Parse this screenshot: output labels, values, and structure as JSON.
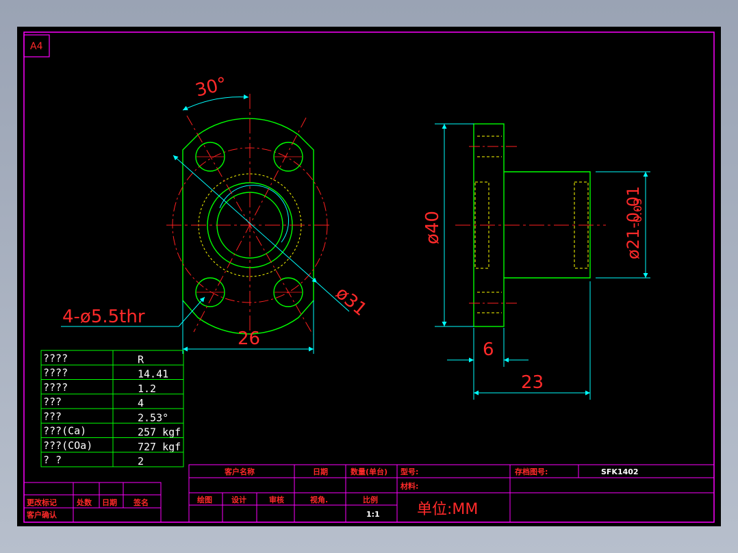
{
  "sheet": {
    "size_label": "A4"
  },
  "front_view": {
    "angle_label": "30°",
    "holes_label": "4-ø5.5thr",
    "pcd_label": "ø31",
    "width_label": "26"
  },
  "side_view": {
    "flange_dia_label": "ø40",
    "shaft_dia_label": "ø21-0.01",
    "shaft_dia_tol": "-0.03",
    "flange_thk_label": "6",
    "length_label": "23"
  },
  "spec_table": {
    "rows": [
      {
        "key": "????",
        "value": "R"
      },
      {
        "key": "????",
        "value": "14.41"
      },
      {
        "key": "????",
        "value": "1.2"
      },
      {
        "key": "???",
        "value": "4"
      },
      {
        "key": "???",
        "value": "2.53°"
      },
      {
        "key": "???(Ca)",
        "value": "257 kgf"
      },
      {
        "key": "???(COa)",
        "value": "727 kgf"
      },
      {
        "key": "?   ?",
        "value": "2"
      }
    ]
  },
  "revision_block": {
    "change_mark": "更改标记",
    "location": "处数",
    "date": "日期",
    "signature": "签名",
    "customer_confirm": "客户确认"
  },
  "title_block": {
    "customer_name": "客户名称",
    "date": "日期",
    "quantity": "数量(单台)",
    "model": "型号:",
    "archive_no": "存档图号:",
    "archive_value": "SFK1402",
    "material": "材料:",
    "drawn": "绘图",
    "design": "设计",
    "review": "审核",
    "view_angle": "视角.",
    "scale": "比例",
    "scale_value": "1:1",
    "unit": "单位:MM"
  },
  "colors": {
    "frame": "#ff00ff",
    "outline": "#00ff00",
    "centerline": "#ff2020",
    "dimension": "#00ffff",
    "hidden": "#ffff00",
    "text": "#ff2a2a"
  }
}
